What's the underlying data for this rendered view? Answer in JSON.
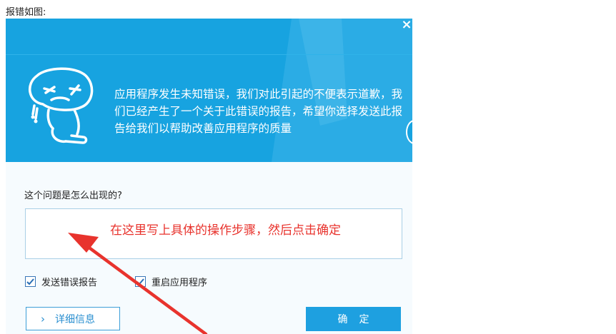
{
  "caption": "报错如图:",
  "dialog": {
    "close_glyph": "×",
    "message": "应用程序发生未知错误，我们对此引起的不便表示道歉，我们已经产生了一个关于此错误的报告，希望你选择发送此报告给我们以帮助改善应用程序的质量",
    "question": "这个问题是怎么出现的?",
    "steps_value": "",
    "annotation": "在这里写上具体的操作步骤，然后点击确定",
    "checkbox_send": {
      "label": "发送错误报告",
      "checked": true
    },
    "checkbox_restart": {
      "label": "重启应用程序",
      "checked": true
    },
    "details_button": "详细信息",
    "details_chevron": "›",
    "ok_button": "确定"
  },
  "colors": {
    "header": "#17a3e0",
    "annotation": "#e8332d",
    "button": "#1ea0e0"
  },
  "icons": [
    "crying-face-mascot-icon",
    "close-icon",
    "checkbox-check-icon",
    "chevron-right-icon",
    "annotation-arrow"
  ]
}
